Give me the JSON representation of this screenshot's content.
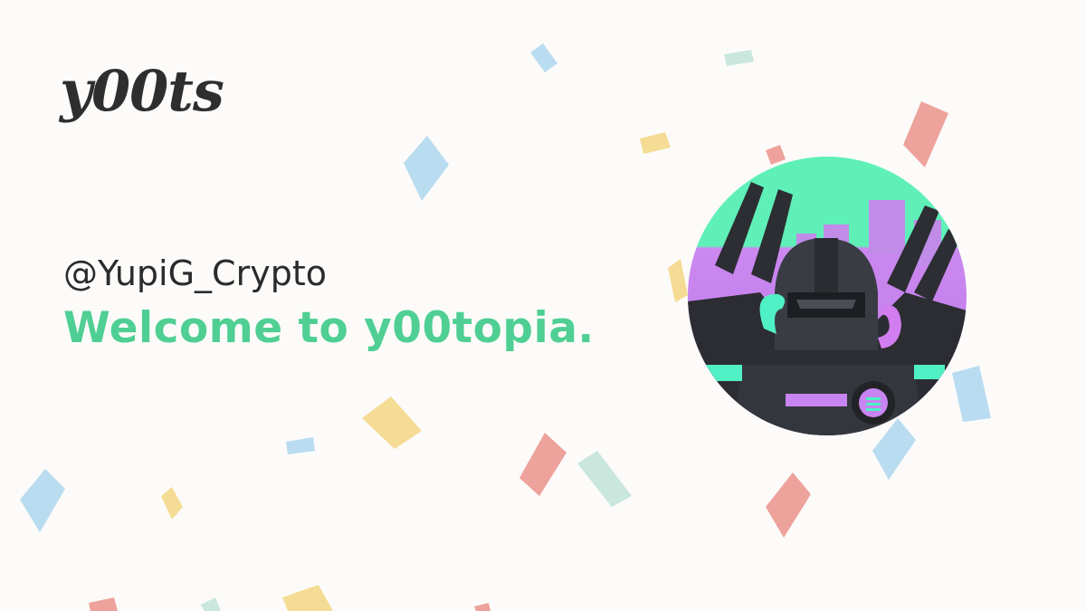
{
  "brand": {
    "logo_text": "y00ts"
  },
  "profile": {
    "handle": "@YupiG_Crypto",
    "welcome": "Welcome to y00topia.",
    "avatar_label": "y00t avatar"
  },
  "colors": {
    "background": "#fcfbf9",
    "welcome_green": "#4fcf93",
    "text_dark": "#2b2b2b",
    "confetti_blue": "#b9dcf0",
    "confetti_red": "#eea29c",
    "confetti_yellow": "#f5dc95",
    "confetti_mint": "#c9e7dc"
  }
}
